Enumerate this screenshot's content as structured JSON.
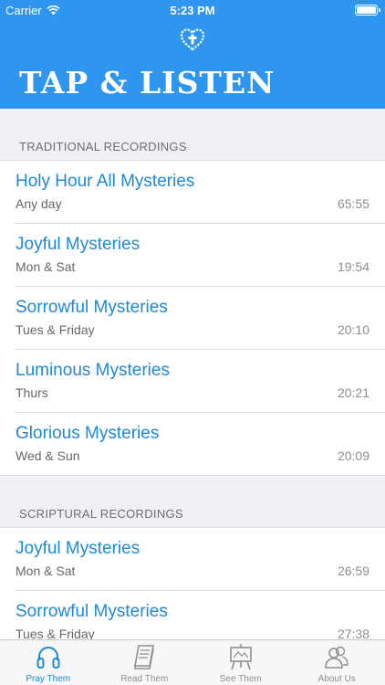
{
  "status": {
    "carrier": "Carrier",
    "time": "5:23 PM"
  },
  "header": {
    "title": "TAP & LISTEN"
  },
  "sections": [
    {
      "title": "TRADITIONAL RECORDINGS",
      "rows": [
        {
          "title": "Holy Hour All Mysteries",
          "subtitle": "Any day",
          "duration": "65:55"
        },
        {
          "title": "Joyful Mysteries",
          "subtitle": "Mon & Sat",
          "duration": "19:54"
        },
        {
          "title": "Sorrowful Mysteries",
          "subtitle": "Tues & Friday",
          "duration": "20:10"
        },
        {
          "title": "Luminous Mysteries",
          "subtitle": "Thurs",
          "duration": "20:21"
        },
        {
          "title": "Glorious Mysteries",
          "subtitle": "Wed & Sun",
          "duration": "20:09"
        }
      ]
    },
    {
      "title": "SCRIPTURAL RECORDINGS",
      "rows": [
        {
          "title": "Joyful Mysteries",
          "subtitle": "Mon & Sat",
          "duration": "26:59"
        },
        {
          "title": "Sorrowful Mysteries",
          "subtitle": "Tues & Friday",
          "duration": "27:38"
        }
      ]
    }
  ],
  "tabs": [
    {
      "label": "Pray Them",
      "icon": "headphones-icon"
    },
    {
      "label": "Read Them",
      "icon": "book-icon"
    },
    {
      "label": "See Them",
      "icon": "easel-icon"
    },
    {
      "label": "About Us",
      "icon": "people-icon"
    }
  ],
  "colors": {
    "header": "#2e96ee",
    "accent": "#1e89d6",
    "background": "#efeff4"
  }
}
